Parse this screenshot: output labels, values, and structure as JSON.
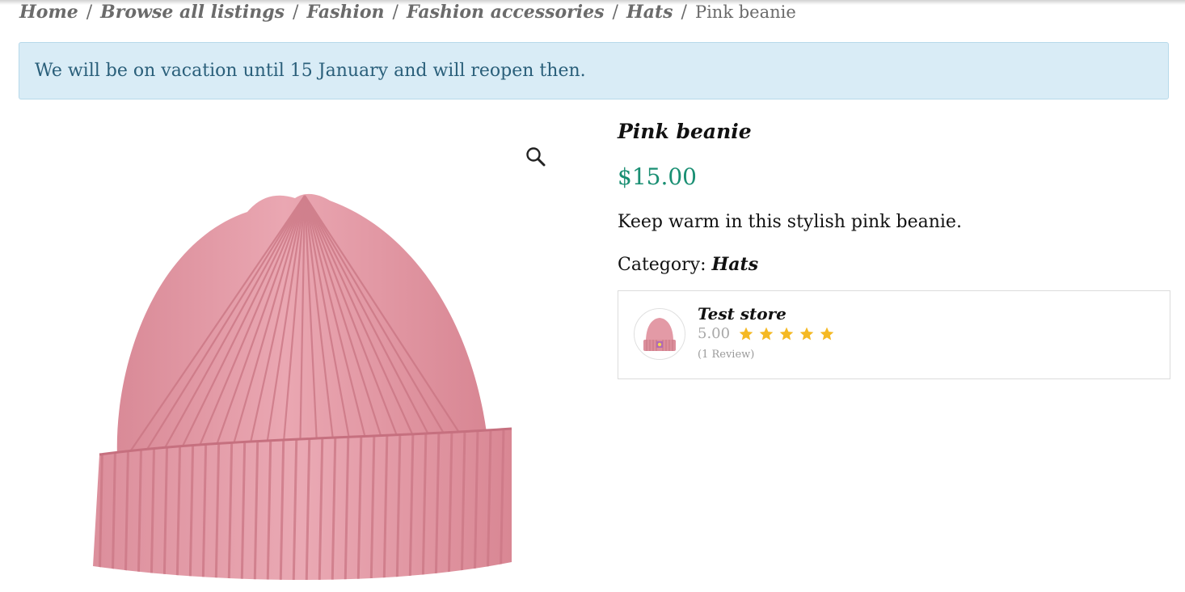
{
  "breadcrumb": {
    "items": [
      "Home",
      "Browse all listings",
      "Fashion",
      "Fashion accessories",
      "Hats"
    ],
    "separator": "/",
    "current": "Pink beanie"
  },
  "notice": {
    "text": "We will be on vacation until 15 January and will reopen then."
  },
  "product": {
    "title": "Pink beanie",
    "price": "$15.00",
    "description": "Keep warm in this stylish pink beanie.",
    "category_label": "Category:",
    "category_value": "Hats",
    "image_icon": "zoom-magnifier-icon"
  },
  "store": {
    "name": "Test store",
    "rating": "5.00",
    "stars": 5,
    "reviews": "(1 Review)"
  },
  "colors": {
    "price": "#1a8f73",
    "notice_bg": "#d9ecf6",
    "notice_text": "#2a5f7a",
    "star": "#f5b923",
    "beanie": "#e39aa6"
  }
}
